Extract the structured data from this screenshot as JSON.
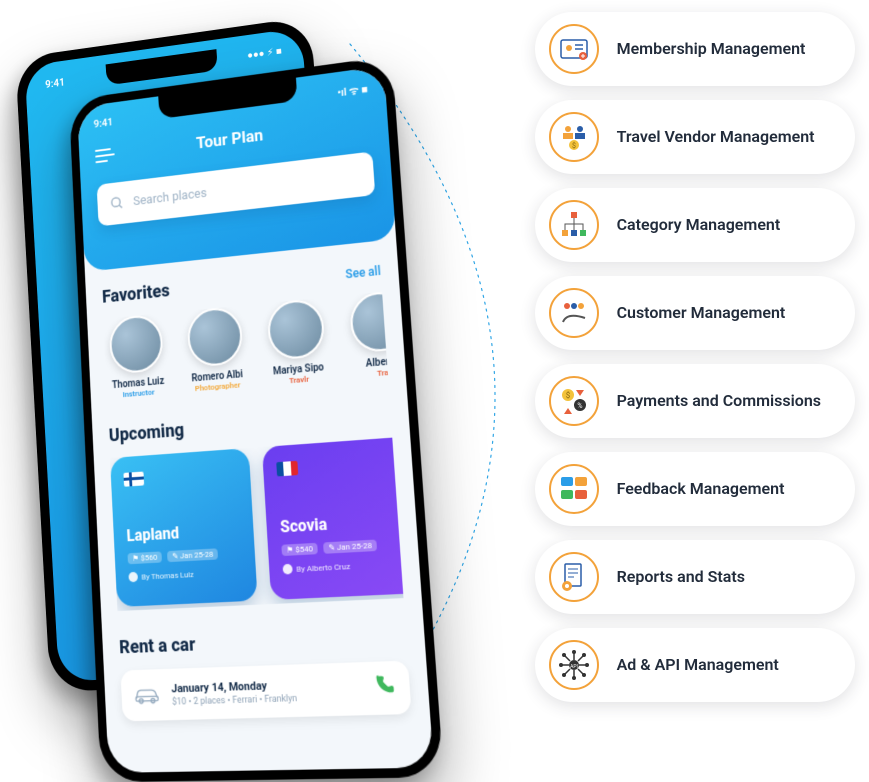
{
  "back_phone": {
    "time": "9:41"
  },
  "app": {
    "time": "9:41",
    "title": "Tour Plan",
    "search_placeholder": "Search places",
    "favorites_heading": "Favorites",
    "see_all": "See all",
    "favorites": [
      {
        "name": "Thomas Luiz",
        "role": "Instructor",
        "roleClass": "role-instr"
      },
      {
        "name": "Romero Albi",
        "role": "Photographer",
        "roleClass": "role-photo"
      },
      {
        "name": "Mariya Sipo",
        "role": "Travlr",
        "roleClass": "role-travlr"
      },
      {
        "name": "Alberto",
        "role": "Tra",
        "roleClass": "role-travlr"
      }
    ],
    "upcoming_heading": "Upcoming",
    "upcoming": [
      {
        "flag": "flag-fi",
        "dest": "Lapland",
        "price": "$560",
        "dates": "Jan 25-28",
        "by": "By Thomas Luiz",
        "card": ""
      },
      {
        "flag": "flag-fr",
        "dest": "Scovia",
        "price": "$540",
        "dates": "Jan 25-28",
        "by": "By Alberto Cruz",
        "card": "purple"
      }
    ],
    "rent_heading": "Rent a car",
    "rent": {
      "date": "January 14, Monday",
      "meta": "$10 • 2 places • Ferrari • Franklyn"
    }
  },
  "features": [
    {
      "label": "Membership Management",
      "icon": "id-card"
    },
    {
      "label": "Travel Vendor Management",
      "icon": "vendor"
    },
    {
      "label": "Category Management",
      "icon": "tree"
    },
    {
      "label": "Customer Management",
      "icon": "customers"
    },
    {
      "label": "Payments and Commissions",
      "icon": "payments"
    },
    {
      "label": "Feedback Management",
      "icon": "feedback"
    },
    {
      "label": "Reports and Stats",
      "icon": "reports"
    },
    {
      "label": "Ad & API Management",
      "icon": "api"
    }
  ]
}
